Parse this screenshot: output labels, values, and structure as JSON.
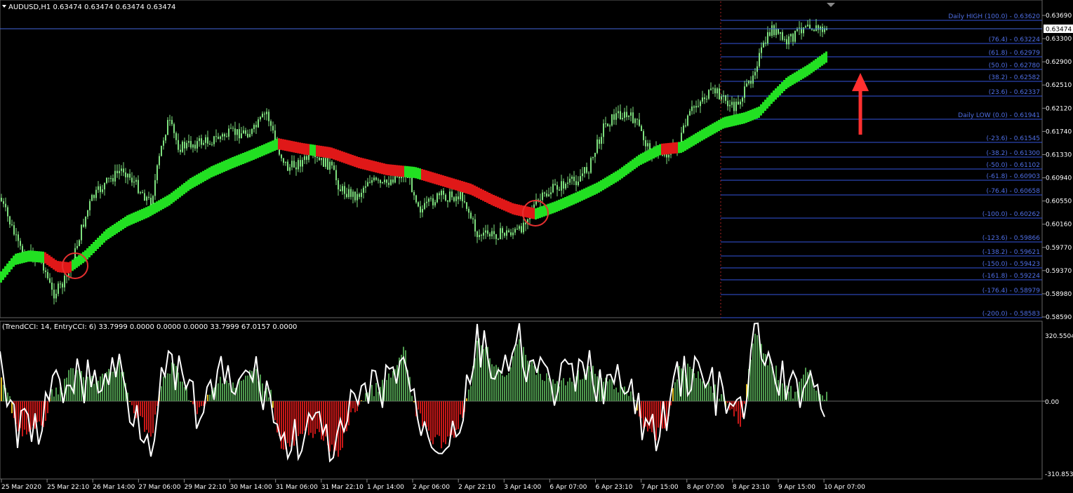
{
  "main_pane": {
    "symbol_header": "AUDUSD,H1  0.63474 0.63474 0.63474 0.63474",
    "current_price": "0.63474",
    "price_axis": [
      "0.63690",
      "0.63300",
      "0.62900",
      "0.62510",
      "0.62120",
      "0.61740",
      "0.61330",
      "0.60940",
      "0.60550",
      "0.60160",
      "0.59770",
      "0.59370",
      "0.58980",
      "0.58590"
    ]
  },
  "fib_levels": [
    {
      "label": "Daily HIGH (100.0) - 0.63620"
    },
    {
      "label": "(76.4) - 0.63224"
    },
    {
      "label": "(61.8) - 0.62979"
    },
    {
      "label": "(50.0) - 0.62780"
    },
    {
      "label": "(38.2) - 0.62582"
    },
    {
      "label": "(23.6) - 0.62337"
    },
    {
      "label": "Daily LOW (0.0) - 0.61941"
    },
    {
      "label": "(-23.6) - 0.61545"
    },
    {
      "label": "(-38.2) - 0.61300"
    },
    {
      "label": "(-50.0) - 0.61102"
    },
    {
      "label": "(-61.8) - 0.60903"
    },
    {
      "label": "(-76.4) - 0.60658"
    },
    {
      "label": "(-100.0) - 0.60262"
    },
    {
      "label": "(-123.6) - 0.59866"
    },
    {
      "label": "(-138.2) - 0.59621"
    },
    {
      "label": "(-150.0) - 0.59423"
    },
    {
      "label": "(-161.8) - 0.59224"
    },
    {
      "label": "(-176.4) - 0.58979"
    },
    {
      "label": "(-200.0) - 0.58583"
    }
  ],
  "indicator_pane": {
    "header": "(TrendCCI: 14, EntryCCI: 6)  33.7999 0.0000 0.0000 0.0000 33.7999 67.0157 0.0000",
    "axis_top": "320.5504",
    "axis_zero": "0.00",
    "axis_bottom": "-310.8532"
  },
  "time_axis": [
    "25 Mar 2020",
    "25 Mar 22:10",
    "26 Mar 14:00",
    "27 Mar 06:00",
    "29 Mar 22:10",
    "30 Mar 14:00",
    "31 Mar 06:00",
    "31 Mar 22:10",
    "1 Apr 14:00",
    "2 Apr 06:00",
    "2 Apr 22:10",
    "3 Apr 14:00",
    "6 Apr 07:00",
    "6 Apr 23:10",
    "7 Apr 15:00",
    "8 Apr 07:00",
    "8 Apr 23:10",
    "9 Apr 15:00",
    "10 Apr 07:00"
  ],
  "colors": {
    "background": "#000000",
    "candle": "#7ee07e",
    "trend_up": "#22e022",
    "trend_down": "#e01818",
    "fib_line": "#3355dd",
    "fib_text": "#4f6fe6",
    "cci_pos": "#4e9a4e",
    "cci_neg": "#c81818",
    "cci_transition": "#e6c020",
    "entry_line": "#ffffff",
    "arrow": "#ff3030",
    "circle": "#e53030"
  }
}
